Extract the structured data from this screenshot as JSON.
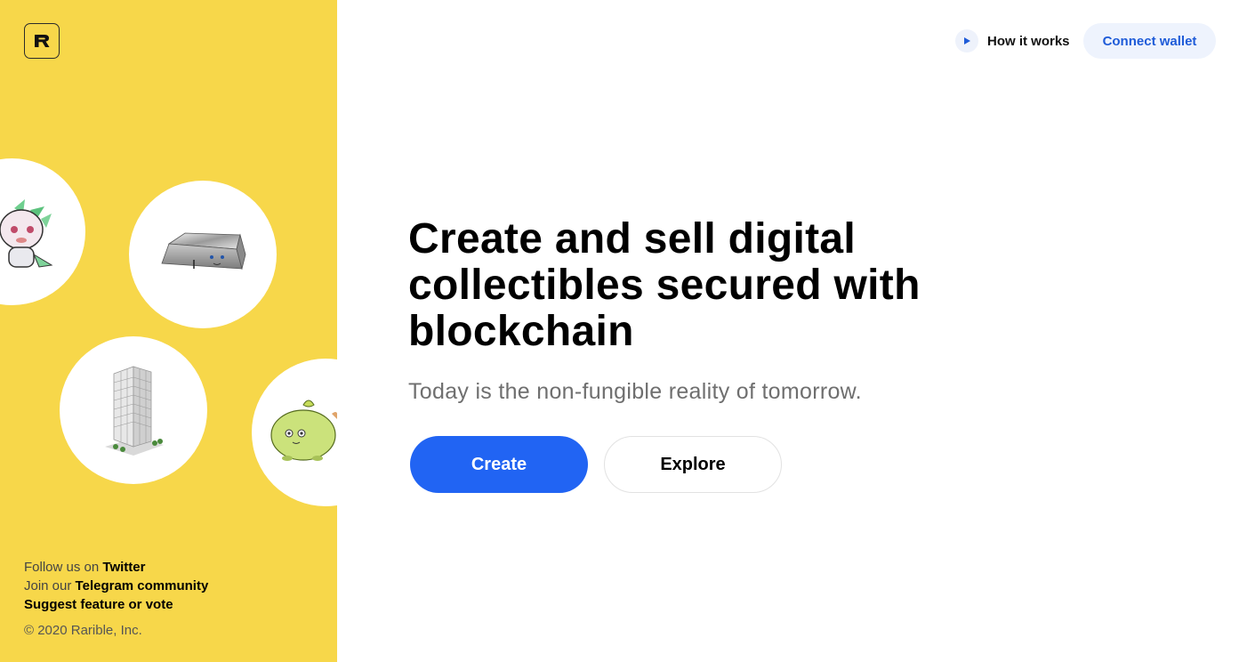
{
  "brand": {
    "logo_letter": "R",
    "logo_icon": "rarible-logo-icon"
  },
  "header": {
    "how_it_works_label": "How it works",
    "play_icon": "play-icon",
    "connect_wallet_label": "Connect wallet"
  },
  "hero": {
    "title": "Create and sell digital collectibles secured with blockchain",
    "subtitle": "Today is the non-fungible reality of tomorrow.",
    "create_label": "Create",
    "explore_label": "Explore"
  },
  "illustrations": [
    {
      "icon": "dragon-creature-icon"
    },
    {
      "icon": "silver-bar-icon"
    },
    {
      "icon": "office-building-icon"
    },
    {
      "icon": "green-creature-icon"
    }
  ],
  "footer": {
    "follow_prefix": "Follow us on",
    "follow_link": "Twitter",
    "join_prefix": "Join our",
    "join_link": "Telegram community",
    "suggest_link": "Suggest feature or vote",
    "copyright": "© 2020 Rarible, Inc."
  },
  "colors": {
    "sidebar_yellow": "#f7d74a",
    "primary_blue": "#2164f3",
    "wallet_bg": "#eef3fd",
    "wallet_text": "#1e5bd8"
  }
}
